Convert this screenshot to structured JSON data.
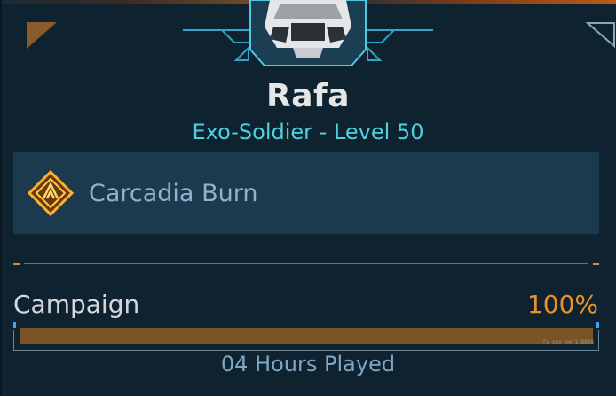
{
  "character": {
    "name": "Rafa",
    "subtitle": "Exo-Soldier - Level 50"
  },
  "location": {
    "name": "Carcadia Burn",
    "icon": "location-emblem-icon"
  },
  "campaign": {
    "label": "Campaign",
    "progress_text": "100%",
    "progress": 1.0,
    "tiny_text": "fx xxx ver1.8888"
  },
  "played": {
    "text": "04 Hours Played"
  },
  "colors": {
    "accent_cyan": "#4fd0e0",
    "accent_orange": "#e9922a",
    "panel_bg": "#1b3a4e",
    "background": "#0f2230",
    "progress_fill": "#7a5326"
  },
  "icons": {
    "emblem": "character-helmet-icon",
    "corner_left": "corner-triangle-icon",
    "corner_right": "corner-triangle-icon"
  }
}
